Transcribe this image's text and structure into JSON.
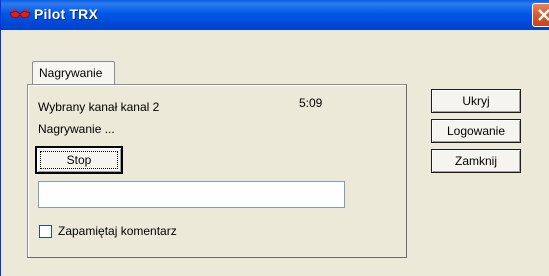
{
  "window": {
    "title": "Pilot TRX",
    "icon": "red-glasses-icon",
    "close_icon": "close-icon"
  },
  "tabs": [
    {
      "label": "Nagrywanie"
    }
  ],
  "recording": {
    "selected_channel": "Wybrany kanał kanal 2",
    "status": "Nagrywanie ...",
    "time": "5:09",
    "stop_label": "Stop",
    "comment_value": "",
    "remember_comment_label": "Zapamiętaj komentarz",
    "remember_comment_checked": false
  },
  "side_buttons": {
    "hide": "Ukryj",
    "logging": "Logowanie",
    "close": "Zamknij"
  },
  "colors": {
    "titlebar": "#0058E6",
    "close_button": "#D85A2A",
    "window_bg": "#ECE9D8"
  }
}
